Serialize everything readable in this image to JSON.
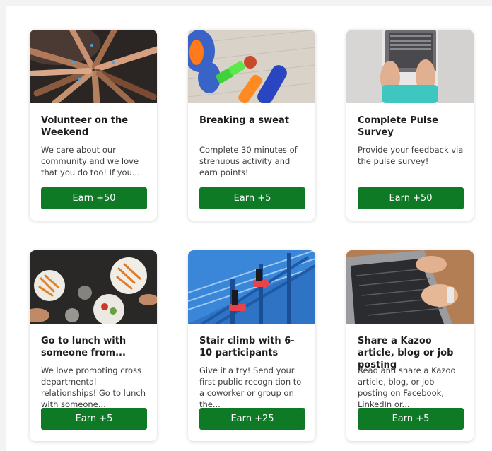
{
  "colors": {
    "earn_button_bg": "#0f7a26",
    "earn_button_text": "#ffffff",
    "card_bg": "#ffffff",
    "page_bg": "#f3f3f4"
  },
  "activities": [
    {
      "image": "hands-together-photo",
      "title": "Volunteer on the Weekend",
      "description": "We care about our community and we love that you do too! If you...",
      "earn_label": "Earn +50"
    },
    {
      "image": "sneakers-dumbbells-bottles-photo",
      "title": "Breaking a sweat",
      "description": "Complete 30 minutes of strenuous activity and earn points!",
      "earn_label": "Earn +5"
    },
    {
      "image": "laptop-on-lap-photo",
      "title": "Complete Pulse Survey",
      "description": "Provide your feedback via the pulse survey!",
      "earn_label": "Earn +50"
    },
    {
      "image": "lunch-table-photo",
      "title": "Go to lunch with someone from...",
      "description": "We love promoting cross departmental relationships! Go to lunch with someone...",
      "earn_label": "Earn +5"
    },
    {
      "image": "stair-climb-photo",
      "title": "Stair climb with 6-10 participants",
      "description": "Give it a try! Send your first public recognition to a coworker or group on the...",
      "earn_label": "Earn +25"
    },
    {
      "image": "typing-on-laptop-photo",
      "title": "Share a Kazoo article, blog or job posting",
      "description": "Read and share a Kazoo article, blog, or job posting on Facebook, LinkedIn or...",
      "earn_label": "Earn +5"
    }
  ]
}
